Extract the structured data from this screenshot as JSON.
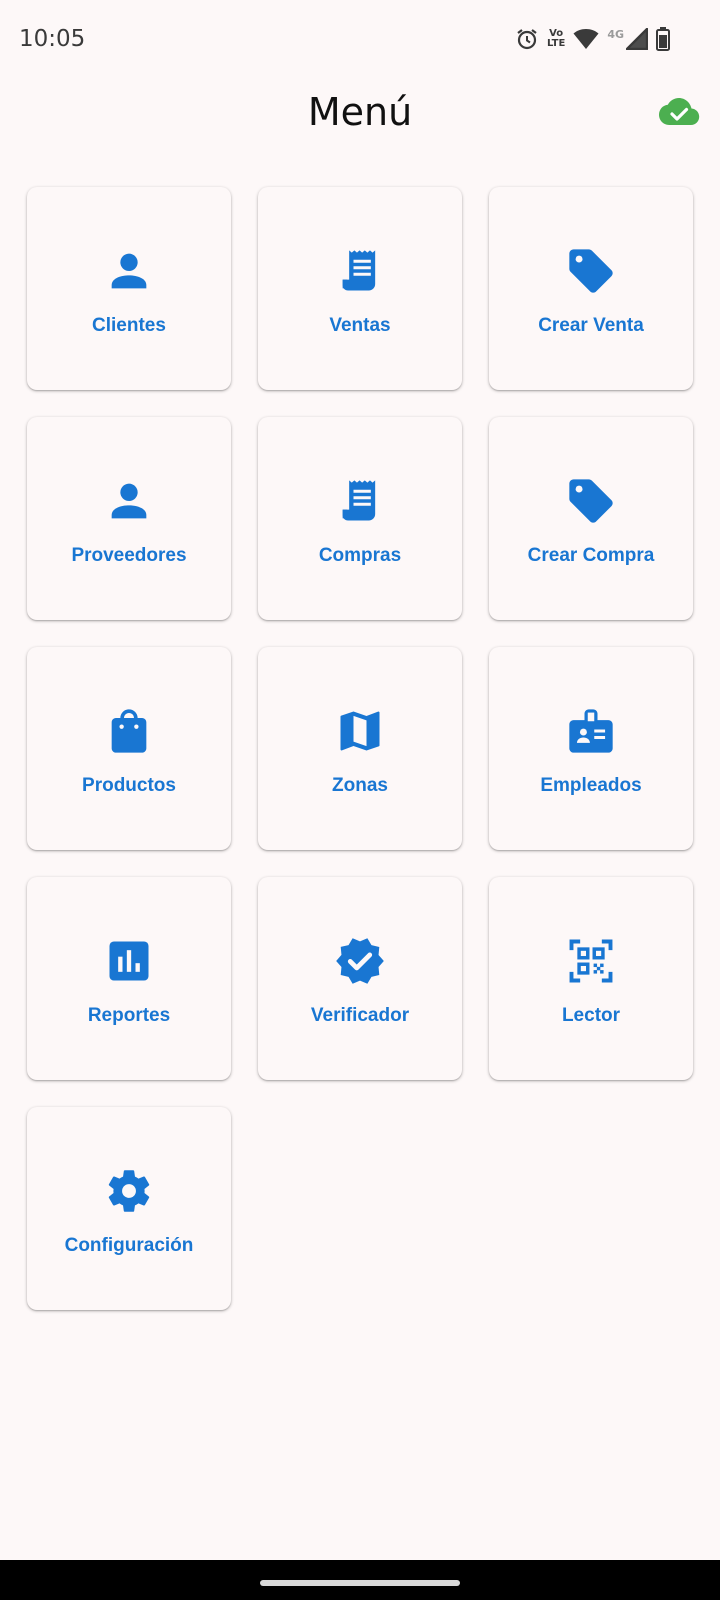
{
  "status_bar": {
    "time": "10:05",
    "icons": [
      "alarm-icon",
      "volte-icon",
      "wifi-icon",
      "network-4g-icon",
      "cell-signal-icon",
      "battery-icon"
    ],
    "volte_top": "Vo",
    "volte_bottom": "LTE",
    "network_type": "4G"
  },
  "header": {
    "title": "Menú",
    "sync_icon": "cloud-done-icon",
    "sync_color": "#4caf50"
  },
  "colors": {
    "accent": "#1976d2",
    "background": "#fdf8f8"
  },
  "menu": {
    "items": [
      {
        "label": "Clientes",
        "icon": "person-icon"
      },
      {
        "label": "Ventas",
        "icon": "receipt-icon"
      },
      {
        "label": "Crear Venta",
        "icon": "tag-icon"
      },
      {
        "label": "Proveedores",
        "icon": "person-icon"
      },
      {
        "label": "Compras",
        "icon": "receipt-icon"
      },
      {
        "label": "Crear Compra",
        "icon": "tag-icon"
      },
      {
        "label": "Productos",
        "icon": "shopping-bag-icon"
      },
      {
        "label": "Zonas",
        "icon": "map-icon"
      },
      {
        "label": "Empleados",
        "icon": "badge-icon"
      },
      {
        "label": "Reportes",
        "icon": "bar-chart-icon"
      },
      {
        "label": "Verificador",
        "icon": "verified-icon"
      },
      {
        "label": "Lector",
        "icon": "qr-scanner-icon"
      },
      {
        "label": "Configuración",
        "icon": "settings-icon"
      }
    ]
  }
}
